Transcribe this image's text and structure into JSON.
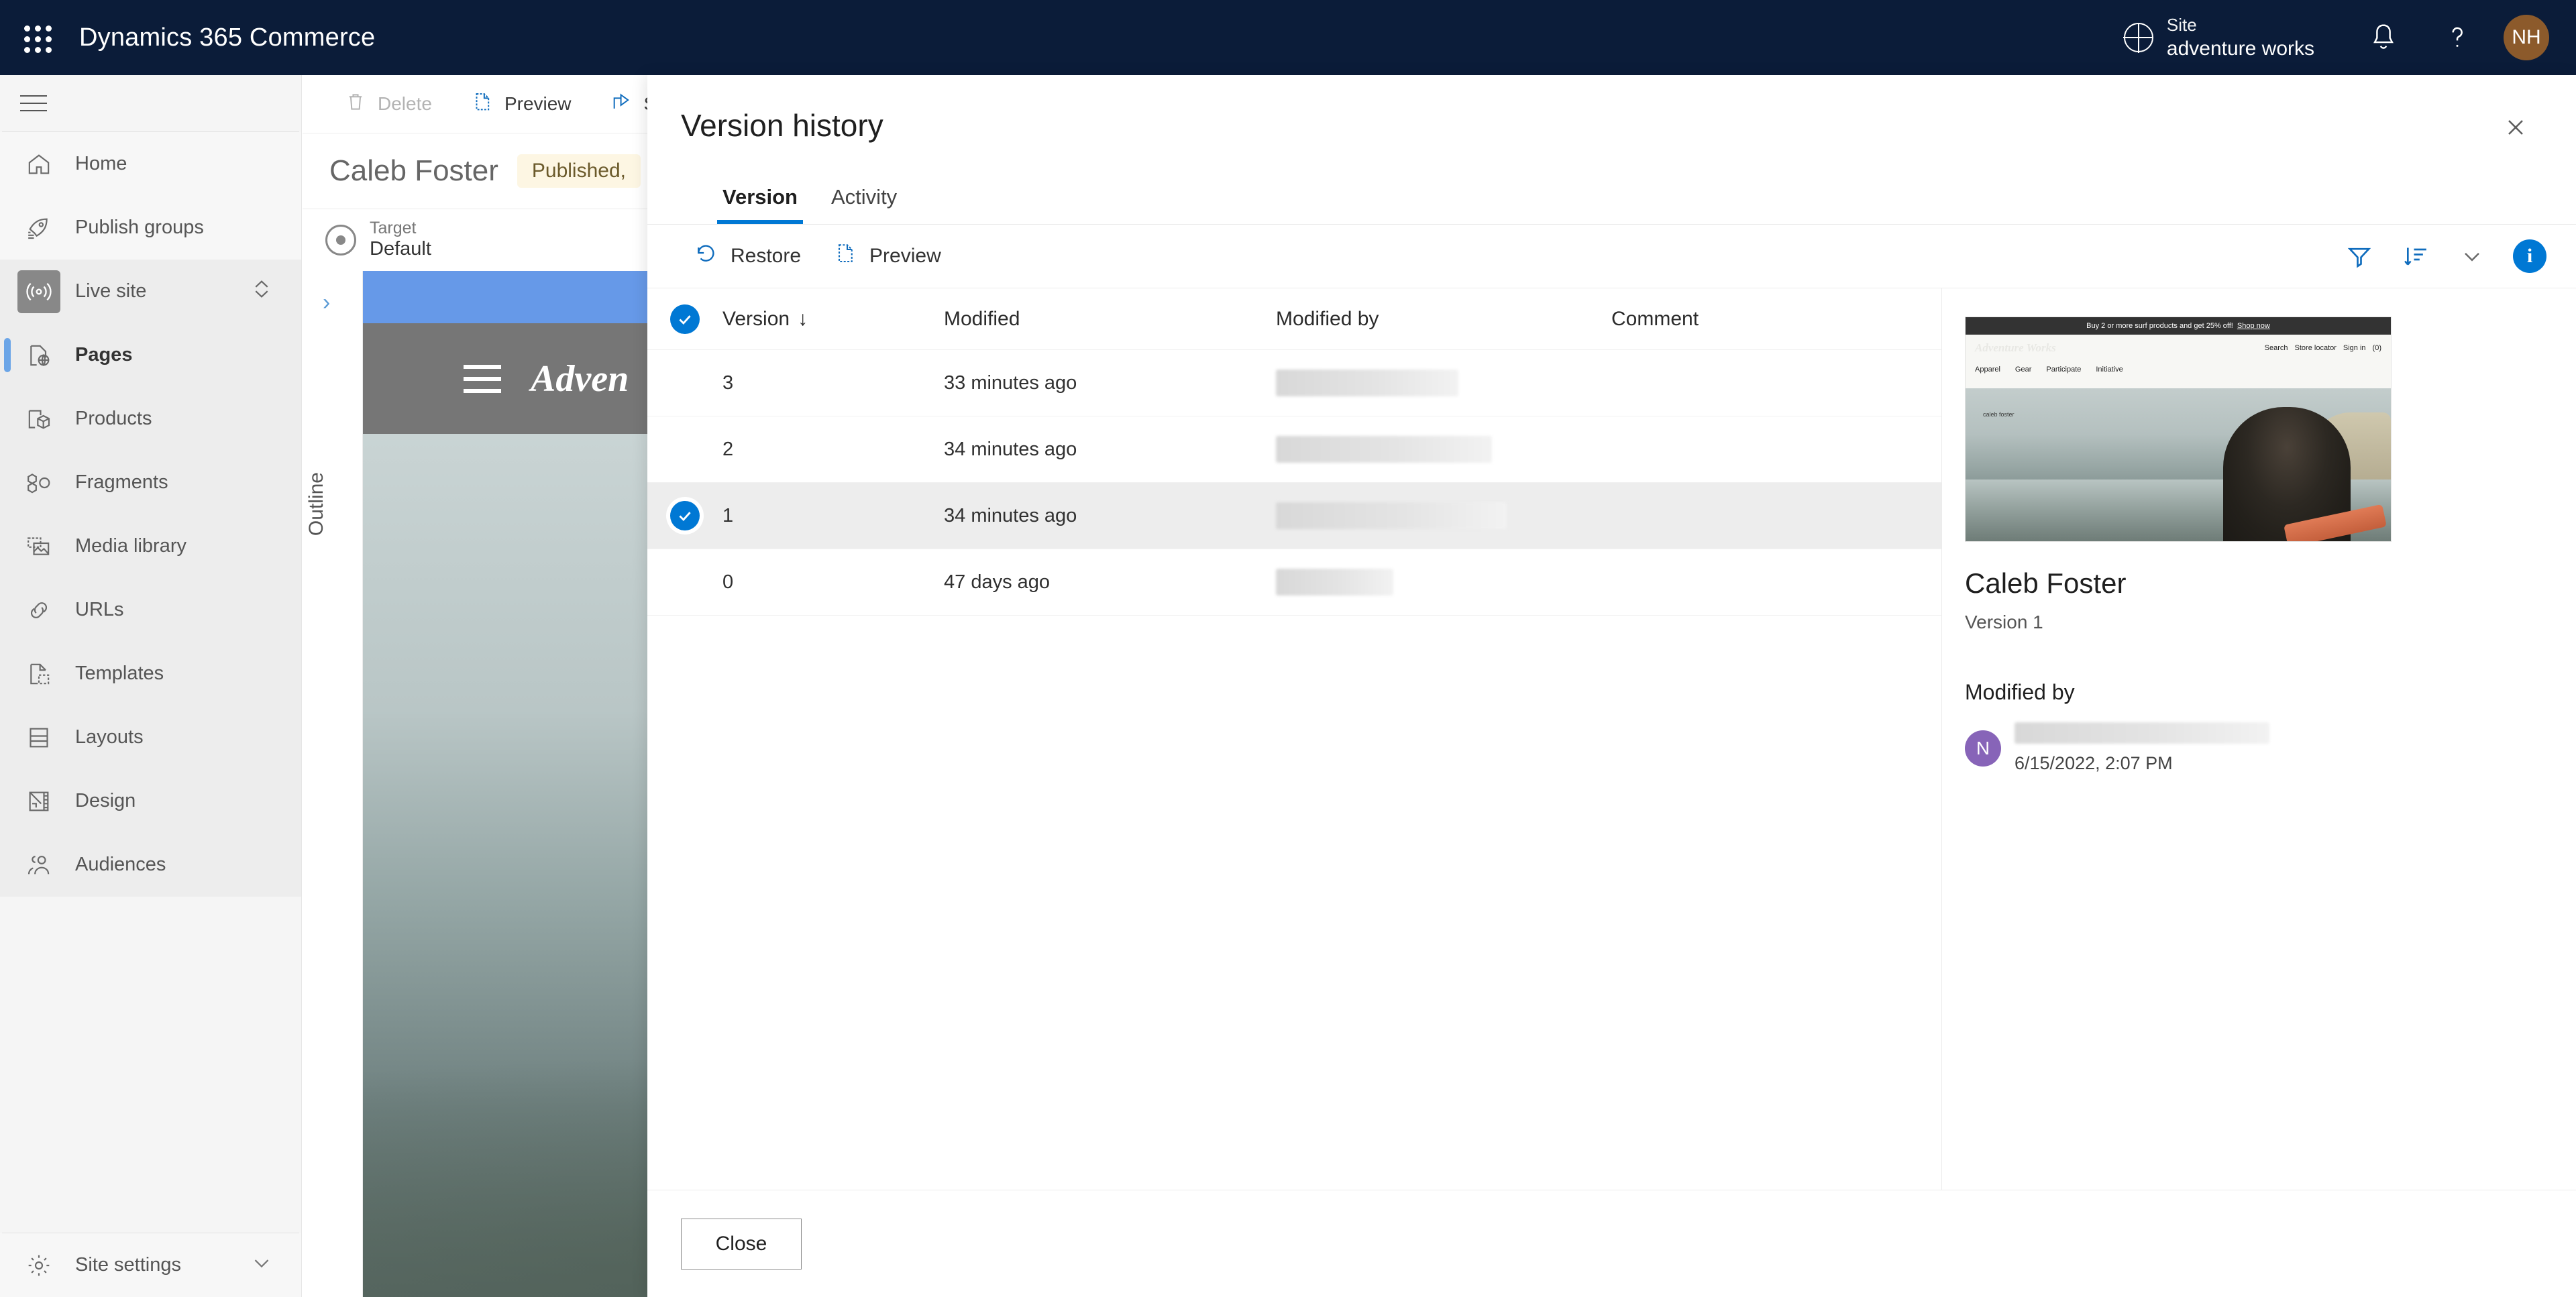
{
  "topbar": {
    "waffle_icon": "app-launcher-icon",
    "brand": "Dynamics 365 Commerce",
    "globe_icon": "globe-icon",
    "site_label": "Site",
    "site_name": "adventure works",
    "notification_icon": "bell-icon",
    "help_icon": "question-mark-icon",
    "avatar_initials": "NH",
    "avatar_color": "#8c5a2b",
    "background_color": "#0b1c39"
  },
  "sidebar": {
    "hamburger_icon": "hamburger-menu-icon",
    "items": [
      {
        "label": "Home",
        "icon": "home-icon"
      },
      {
        "label": "Publish groups",
        "icon": "rocket-list-icon"
      },
      {
        "label": "Live site",
        "icon": "broadcast-icon",
        "chevron": "chevron-up-down-icon"
      },
      {
        "label": "Pages",
        "icon": "page-globe-icon",
        "active": true
      },
      {
        "label": "Products",
        "icon": "box-icon"
      },
      {
        "label": "Fragments",
        "icon": "fragments-icon"
      },
      {
        "label": "Media library",
        "icon": "media-image-icon"
      },
      {
        "label": "URLs",
        "icon": "link-icon"
      },
      {
        "label": "Templates",
        "icon": "template-icon"
      },
      {
        "label": "Layouts",
        "icon": "layout-icon"
      },
      {
        "label": "Design",
        "icon": "ruler-pencil-icon"
      },
      {
        "label": "Audiences",
        "icon": "people-icon"
      }
    ],
    "footer": {
      "label": "Site settings",
      "icon": "gear-icon",
      "chevron": "chevron-down-icon"
    }
  },
  "editor": {
    "commands": [
      {
        "label": "Delete",
        "icon": "trash-icon",
        "disabled": true
      },
      {
        "label": "Preview",
        "icon": "preview-page-icon",
        "disabled": false
      },
      {
        "label": "S",
        "icon": "share-icon",
        "disabled": false
      }
    ],
    "page_title": "Caleb Foster",
    "status_pill": "Published,",
    "target_label": "Target",
    "target_value": "Default",
    "target_icon": "target-icon",
    "outline_label": "Outline",
    "outline_chevron": "chevron-right-icon",
    "canvas_logo": "Adven",
    "canvas_menu_icon": "hamburger-menu-icon"
  },
  "modal": {
    "title": "Version history",
    "close_icon": "close-icon",
    "tabs": [
      {
        "label": "Version",
        "active": true
      },
      {
        "label": "Activity",
        "active": false
      }
    ],
    "commands": [
      {
        "label": "Restore",
        "icon": "restore-undo-icon"
      },
      {
        "label": "Preview",
        "icon": "preview-page-icon"
      }
    ],
    "right_icons": [
      {
        "name": "filter-icon"
      },
      {
        "name": "sort-descending-icon"
      },
      {
        "name": "chevron-down-icon"
      },
      {
        "name": "info-icon"
      }
    ],
    "accent_color": "#0078d4",
    "table": {
      "select_all_checked": true,
      "columns": [
        "Version",
        "Modified",
        "Modified by",
        "Comment"
      ],
      "sort_column": "Version",
      "sort_direction": "descending",
      "sort_arrow": "↓",
      "rows": [
        {
          "version": "3",
          "modified": "33 minutes ago",
          "modified_by": "",
          "comment": "",
          "selected": false,
          "redact_width": 272
        },
        {
          "version": "2",
          "modified": "34 minutes ago",
          "modified_by": "",
          "comment": "",
          "selected": false,
          "redact_width": 322
        },
        {
          "version": "1",
          "modified": "34 minutes ago",
          "modified_by": "",
          "comment": "",
          "selected": true,
          "redact_width": 344
        },
        {
          "version": "0",
          "modified": "47 days ago",
          "modified_by": "",
          "comment": "",
          "selected": false,
          "redact_width": 175
        }
      ]
    },
    "preview": {
      "thumbnail": {
        "promo_text": "Buy 2 or more surf products and get 25% off!",
        "promo_link": "Shop now",
        "wordmark": "Adventure Works",
        "utils": [
          "Search",
          "Store locator",
          "Sign in"
        ],
        "cart_count": "(0)",
        "nav": [
          "Apparel",
          "Gear",
          "Participate",
          "Initiative"
        ],
        "hero_caption": "caleb foster"
      },
      "title": "Caleb Foster",
      "subtitle": "Version 1",
      "modified_by_heading": "Modified by",
      "author_initial": "N",
      "author_avatar_color": "#8764b8",
      "timestamp": "6/15/2022, 2:07 PM"
    },
    "footer_button": "Close"
  }
}
